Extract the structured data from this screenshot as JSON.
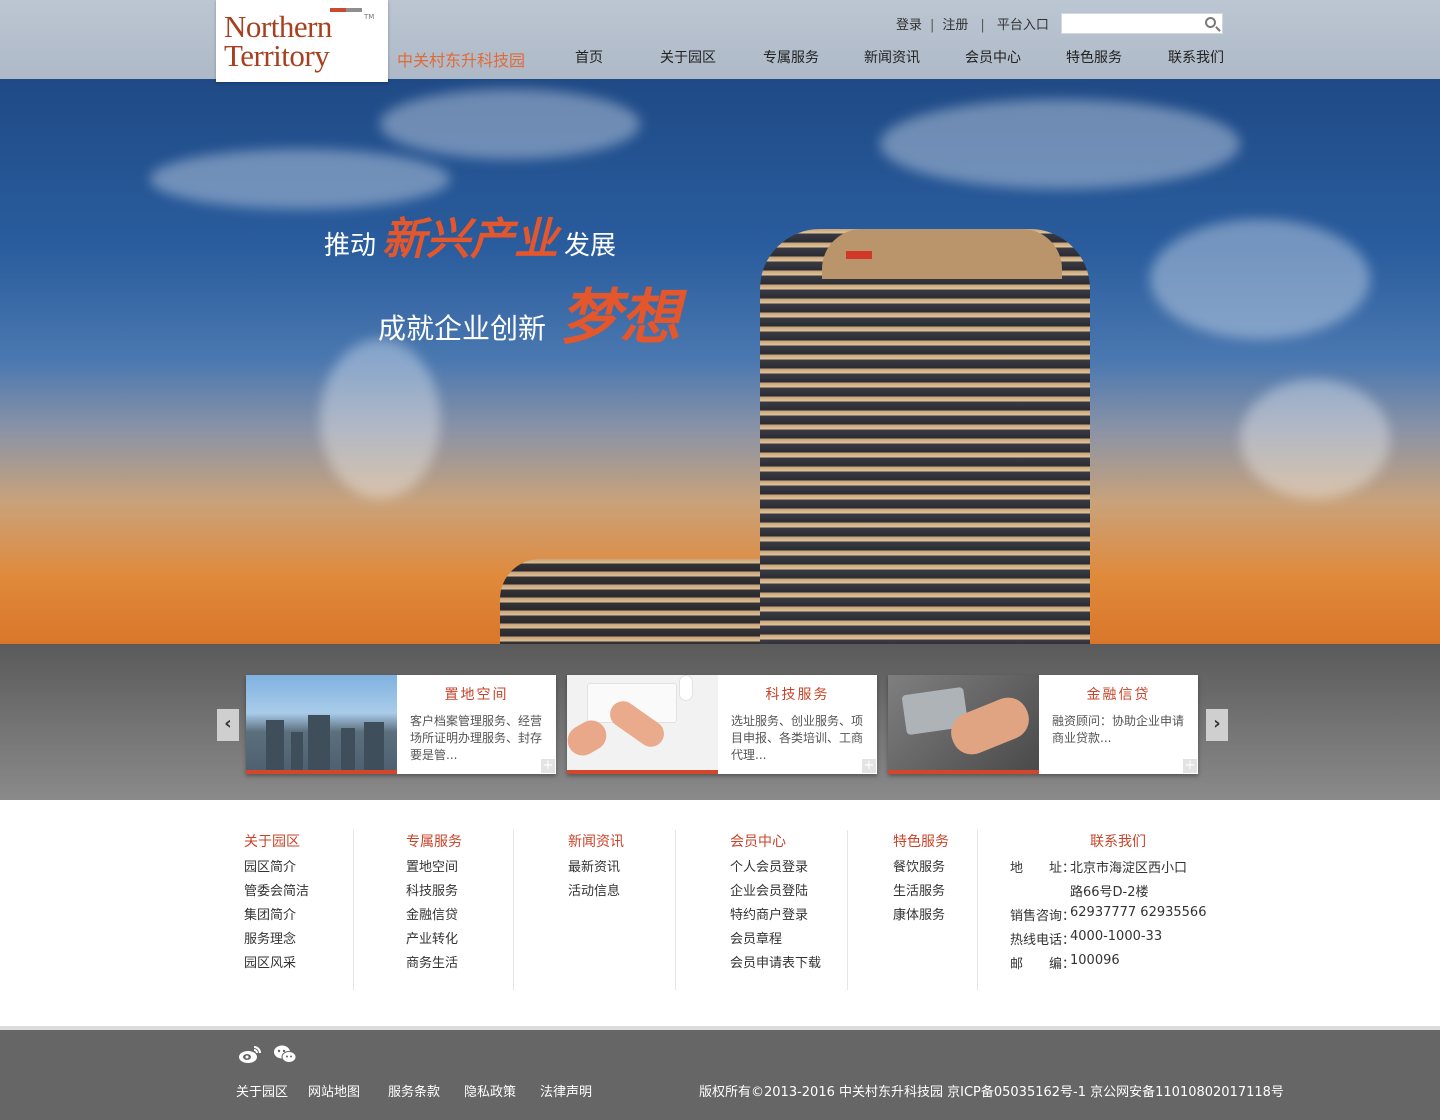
{
  "header": {
    "logo_line1": "Northern",
    "logo_line2": "Territory",
    "logo_tm": "TM",
    "site_name": "中关村东升科技园",
    "login": "登录",
    "register": "注册",
    "platform": "平台入口",
    "search_placeholder": "",
    "nav": [
      "首页",
      "关于园区",
      "专属服务",
      "新闻资讯",
      "会员中心",
      "特色服务",
      "联系我们"
    ]
  },
  "banner": {
    "line1_pre": "推动",
    "line1_hi": "新兴产业",
    "line1_post": "发展",
    "line2_pre": "成就企业创新",
    "line2_hi": "梦想"
  },
  "slider": {
    "prev": "‹",
    "next": "›",
    "cards": [
      {
        "title": "置地空间",
        "desc": "客户档案管理服务、经营场所证明办理服务、封存要是管..."
      },
      {
        "title": "科技服务",
        "desc": "选址服务、创业服务、项目申报、各类培训、工商代理..."
      },
      {
        "title": "金融信贷",
        "desc": "融资顾问：协助企业申请商业贷款..."
      }
    ],
    "more": "+"
  },
  "footer_menu": {
    "about": {
      "title": "关于园区",
      "items": [
        "园区简介",
        "管委会简洁",
        "集团简介",
        "服务理念",
        "园区风采"
      ]
    },
    "services": {
      "title": "专属服务",
      "items": [
        "置地空间",
        "科技服务",
        "金融信贷",
        "产业转化",
        "商务生活"
      ]
    },
    "news": {
      "title": "新闻资讯",
      "items": [
        "最新资讯",
        "活动信息"
      ]
    },
    "member": {
      "title": "会员中心",
      "items": [
        "个人会员登录",
        "企业会员登陆",
        "特约商户登录",
        "会员章程",
        "会员申请表下载"
      ]
    },
    "special": {
      "title": "特色服务",
      "items": [
        "餐饮服务",
        "生活服务",
        "康体服务"
      ]
    },
    "contact": {
      "title": "联系我们",
      "address_label": "地　　址：",
      "address_1": "北京市海淀区西小口",
      "address_2": "路66号D-2楼",
      "sales_label": "销售咨询：",
      "sales": "62937777 62935566",
      "hotline_label": "热线电话：",
      "hotline": "4000-1000-33",
      "zip_label": "邮　　编：",
      "zip": "100096"
    }
  },
  "bottom": {
    "links": [
      "关于园区",
      "网站地图",
      "服务条款",
      "隐私政策",
      "法律声明"
    ],
    "copyright": "版权所有©2013-2016 中关村东升科技园 京ICP备05035162号-1 京公网安备11010802017118号",
    "social": [
      "weibo-icon",
      "wechat-icon"
    ]
  }
}
